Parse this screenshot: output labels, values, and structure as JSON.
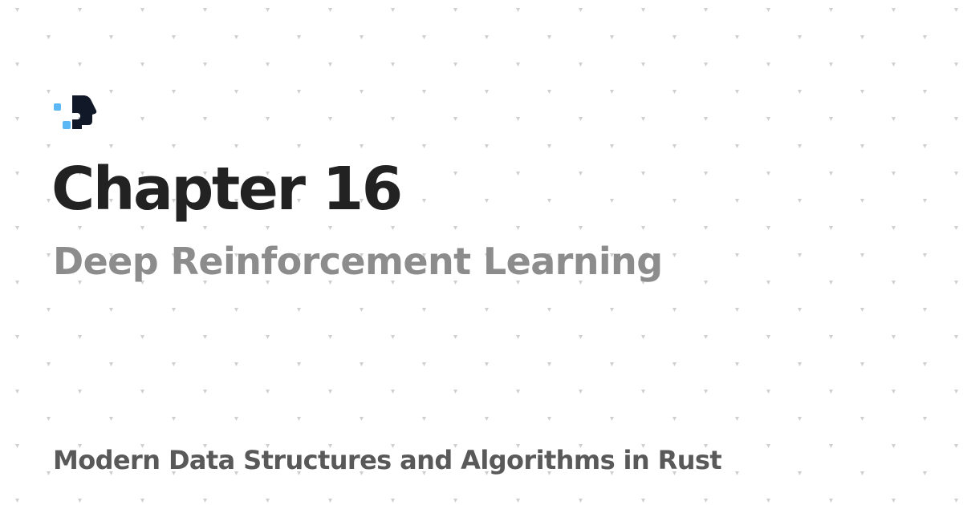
{
  "header": {
    "logo_icon": "puzzle-head-logo-icon"
  },
  "main": {
    "title": "Chapter 16",
    "subtitle": "Deep Reinforcement Learning"
  },
  "footer": {
    "book_title": "Modern Data Structures and Algorithms in Rust"
  },
  "colors": {
    "title": "#222222",
    "subtitle": "#8c8c8c",
    "book_title": "#595959",
    "logo_dark": "#111827",
    "logo_accent": "#5bb8f5",
    "pattern_dot": "#cfcfcf"
  }
}
